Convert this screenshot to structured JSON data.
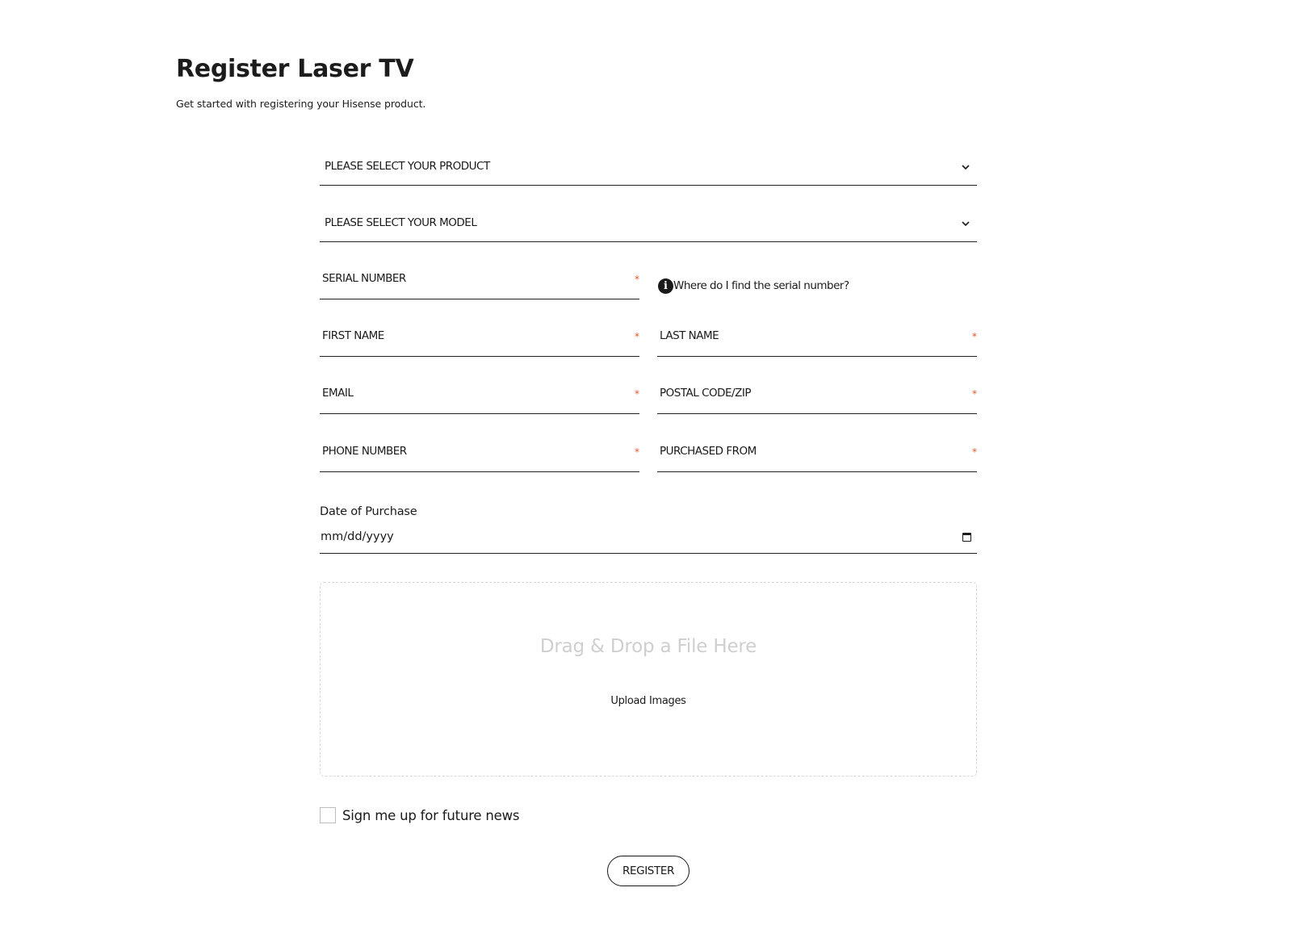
{
  "header": {
    "title": "Register Laser TV",
    "subtitle": "Get started with registering your Hisense product."
  },
  "form": {
    "product_select": {
      "selected": "PLEASE SELECT YOUR PRODUCT",
      "icon": "chevron-down-icon"
    },
    "model_select": {
      "selected": "PLEASE SELECT YOUR MODEL",
      "icon": "chevron-down-icon"
    },
    "required_marker": "*",
    "fields": {
      "serial_number": "SERIAL NUMBER",
      "first_name": "FIRST NAME",
      "last_name": "LAST NAME",
      "email": "EMAIL",
      "postal_code": "POSTAL CODE/ZIP",
      "phone_number": "PHONE NUMBER",
      "purchased_from": "PURCHASED FROM"
    },
    "serial_help": {
      "icon_glyph": "i",
      "text": "Where do I find the serial number?"
    },
    "date_of_purchase": {
      "label": "Date of Purchase",
      "placeholder": "mm/dd/yyyy",
      "icon": "calendar-icon"
    },
    "dropzone": {
      "title": "Drag & Drop a File Here",
      "subtitle": "Upload Images"
    },
    "newsletter": {
      "label": "Sign me up for future news",
      "checked": false
    },
    "submit_label": "REGISTER"
  },
  "colors": {
    "text": "#1a1a1a",
    "required": "#e2562a",
    "underline": "#222222",
    "dropzone_text": "#cfcfcf",
    "dropzone_border": "#d6d6d6"
  }
}
